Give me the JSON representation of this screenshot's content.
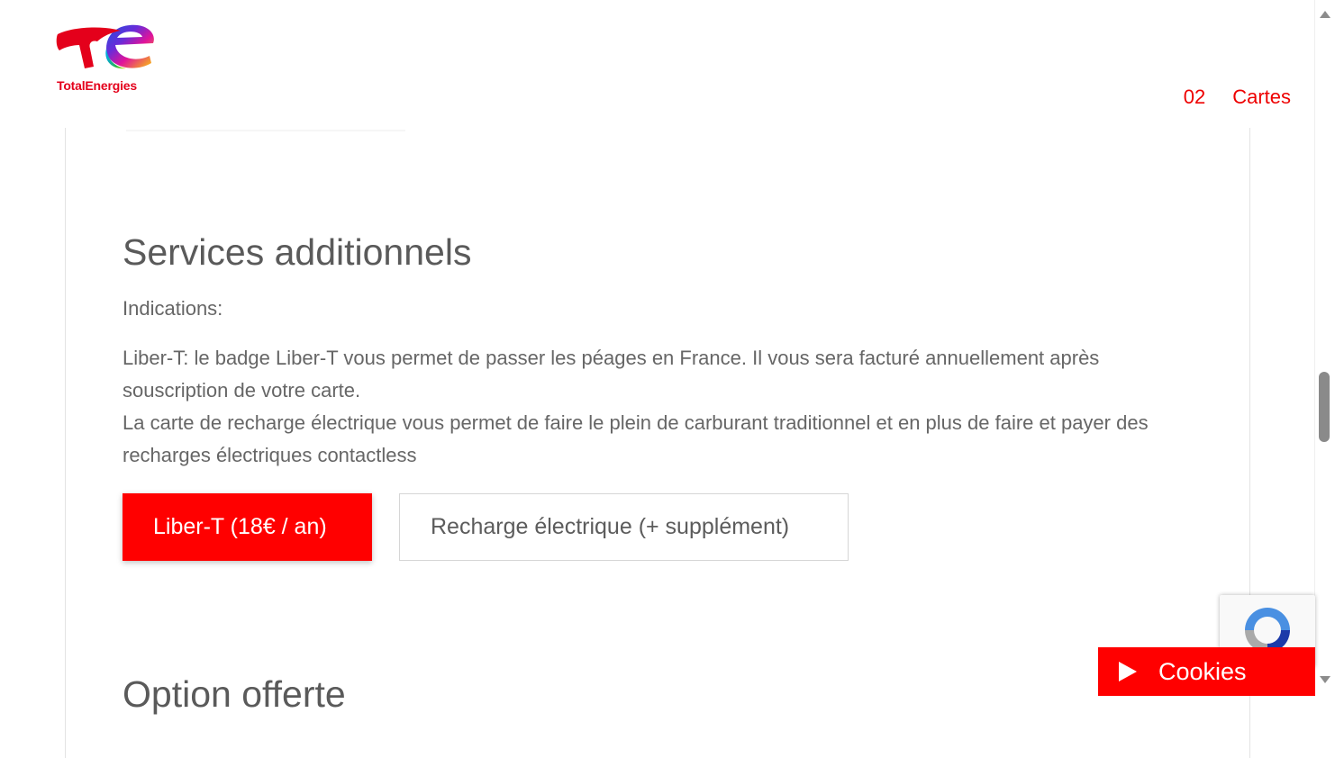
{
  "brand": {
    "name": "TotalEnergies"
  },
  "nav": {
    "items": [
      "02",
      "Cartes"
    ]
  },
  "section": {
    "title": "Services additionnels",
    "indications": "Indications:",
    "paragraphs": [
      "Liber-T: le badge Liber-T vous permet de passer les péages en France. Il vous sera facturé annuellement après souscription de votre carte.",
      "La carte de recharge électrique vous permet de faire le plein de carburant traditionnel et en plus de faire et payer des recharges électriques contactless"
    ],
    "options": [
      {
        "label": "Liber-T (18€ / an)",
        "selected": true
      },
      {
        "label": "Recharge électrique (+ supplément)",
        "selected": false
      }
    ]
  },
  "next_section": {
    "title": "Option offerte"
  },
  "cookies": {
    "label": "Cookies",
    "icon": "play-icon"
  },
  "recaptcha": {
    "icon": "recaptcha-icon"
  },
  "colors": {
    "brand_red": "#ff0000",
    "text_gray": "#5c5c5c"
  }
}
